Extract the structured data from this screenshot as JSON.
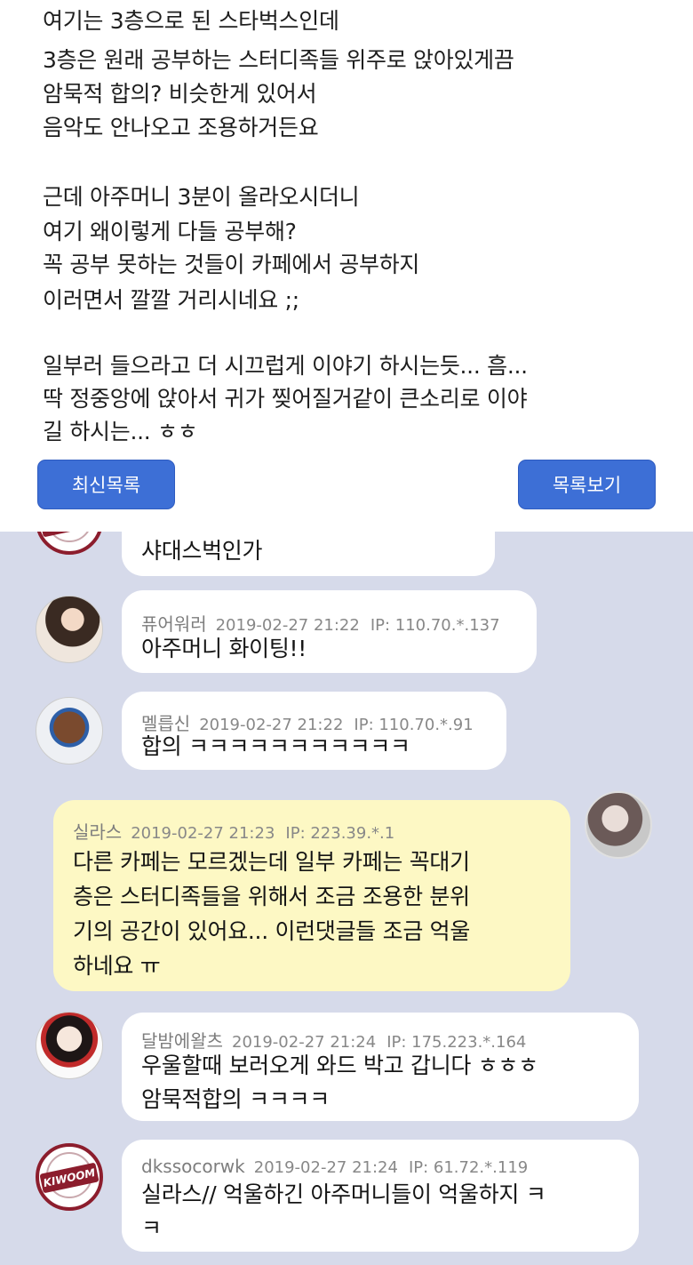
{
  "post": {
    "lines": [
      "여기는 3층으로 된 스타벅스인데",
      "3층은 원래 공부하는 스터디족들 위주로 앉아있게끔",
      "암묵적 합의? 비슷한게 있어서",
      "음악도 안나오고 조용하거든요",
      "",
      "근데 아주머니 3분이 올라오시더니",
      "여기 왜이렇게 다들 공부해?",
      "꼭 공부 못하는 것들이 카페에서 공부하지",
      "이러면서 깔깔 거리시네요 ;;",
      "",
      "일부러 들으라고 더 시끄럽게 이야기 하시는듯... 흠...",
      "딱 정중앙에 앉아서 귀가 찢어질거같이 큰소리로 이야",
      "길 하시는... ㅎㅎ"
    ],
    "buttons": {
      "latest": "최신목록",
      "list": "목록보기"
    }
  },
  "comments": [
    {
      "nick": "",
      "date": "",
      "ip": "",
      "lines": [
        "샤대스벅인가"
      ],
      "avatar": "kiwoom-logo-icon"
    },
    {
      "nick": "퓨어워러",
      "date": "2019-02-27 21:22",
      "ip": "IP: 110.70.*.137",
      "lines": [
        "아주머니 화이팅!!"
      ],
      "avatar": "female-avatar-icon"
    },
    {
      "nick": "멜릅신",
      "date": "2019-02-27 21:22",
      "ip": "IP: 110.70.*.91",
      "lines": [
        "합의 ㅋㅋㅋㅋㅋㅋㅋㅋㅋㅋㅋ"
      ],
      "avatar": "male-avatar-icon"
    },
    {
      "nick": "실라스",
      "date": "2019-02-27 21:23",
      "ip": "IP: 223.39.*.1",
      "lines": [
        "다른 카페는 모르겠는데 일부 카페는 꼭대기",
        "층은 스터디족들을 위해서 조금 조용한 분위",
        "기의 공간이 있어요... 이런댓글들 조금 억울",
        "하네요 ㅠ"
      ],
      "avatar": "female-avatar-icon"
    },
    {
      "nick": "달밤에왈츠",
      "date": "2019-02-27 21:24",
      "ip": "IP: 175.223.*.164",
      "lines": [
        "우울할때 보러오게 와드 박고 갑니다 ㅎㅎㅎ",
        "암묵적합의 ㅋㅋㅋㅋ"
      ],
      "avatar": "female-avatar-icon"
    },
    {
      "nick": "dkssocorwk",
      "date": "2019-02-27 21:24",
      "ip": "IP: 61.72.*.119",
      "lines": [
        "실라스// 억울하긴 아주머니들이 억울하지 ㅋ",
        "ㅋ"
      ],
      "avatar": "kiwoom-logo-icon"
    }
  ],
  "logo_text": "KIWOOM",
  "colors": {
    "button_blue": "#3d6fd6",
    "comment_bg": "#d6daea",
    "my_bubble": "#fdf8c4"
  }
}
